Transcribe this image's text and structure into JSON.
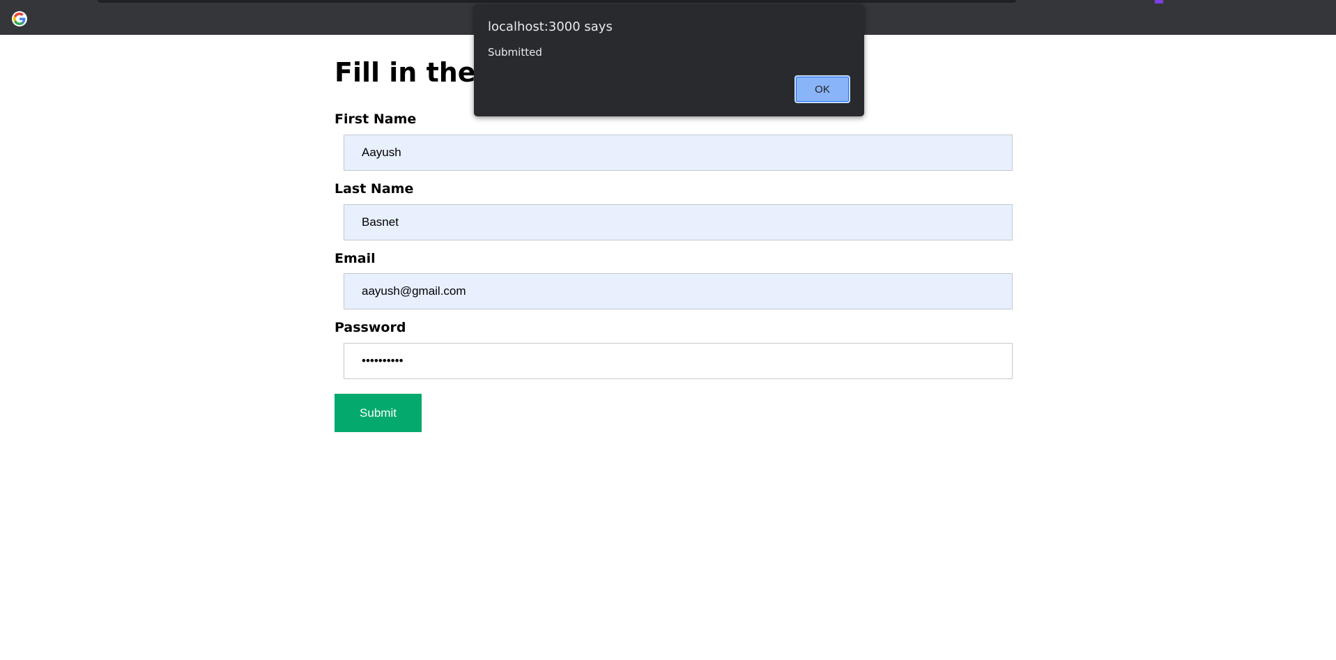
{
  "browser": {
    "icon": "google-icon"
  },
  "form": {
    "title": "Fill in the form",
    "fields": [
      {
        "label": "First Name",
        "value": "Aayush"
      },
      {
        "label": "Last Name",
        "value": "Basnet"
      },
      {
        "label": "Email",
        "value": "aayush@gmail.com"
      },
      {
        "label": "Password",
        "value": "••••••••••"
      }
    ],
    "submit_label": "Submit"
  },
  "alert": {
    "title": "localhost:3000 says",
    "message": "Submitted",
    "ok_label": "OK"
  },
  "colors": {
    "browser_chrome": "#35363a",
    "autofill_bg": "#e8f0fe",
    "submit_bg": "#04aa6d",
    "dialog_bg": "#292a2d",
    "ok_bg": "#8ab4f8"
  }
}
